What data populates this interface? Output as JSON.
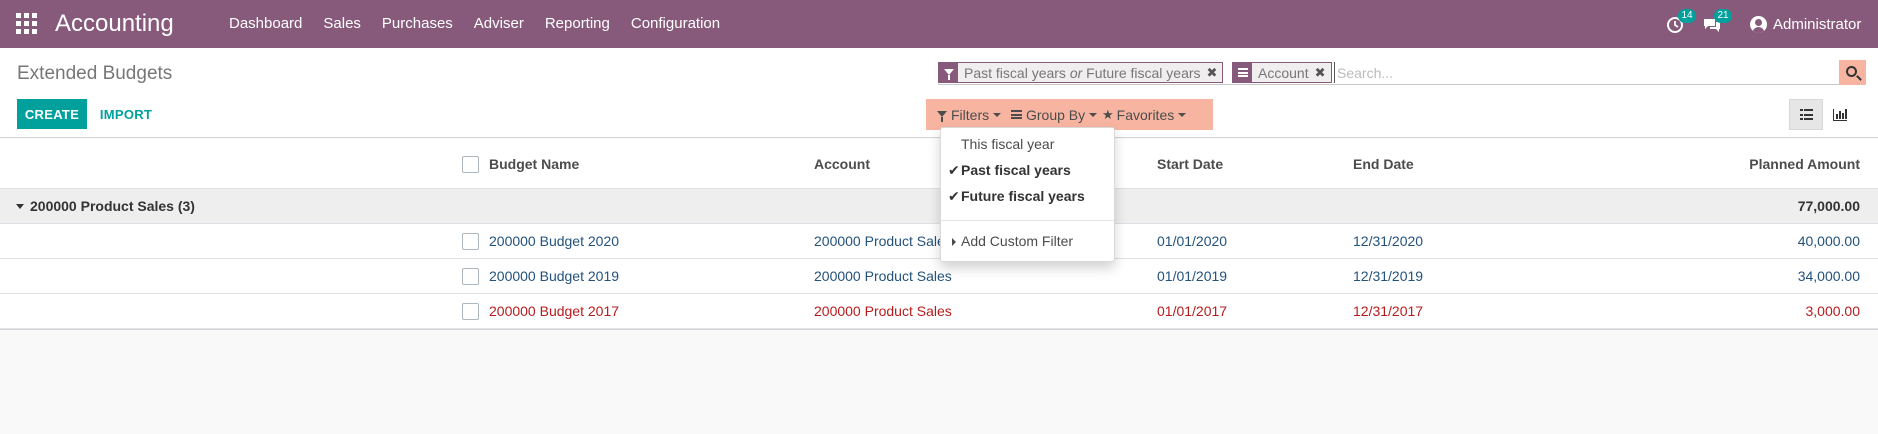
{
  "navbar": {
    "brand": "Accounting",
    "menu": [
      "Dashboard",
      "Sales",
      "Purchases",
      "Adviser",
      "Reporting",
      "Configuration"
    ],
    "activity_count": "14",
    "messages_count": "21",
    "user": "Administrator"
  },
  "control_panel": {
    "title": "Extended Budgets",
    "create_label": "CREATE",
    "import_label": "IMPORT",
    "facets": {
      "filter_part1": "Past fiscal years",
      "filter_or": "or",
      "filter_part2": "Future fiscal years",
      "groupby": "Account"
    },
    "search_placeholder": "Search...",
    "filters_label": "Filters",
    "groupby_label": "Group By",
    "favorites_label": "Favorites"
  },
  "filters_dropdown": {
    "items": [
      {
        "label": "This fiscal year",
        "selected": false
      },
      {
        "label": "Past fiscal years",
        "selected": true
      },
      {
        "label": "Future fiscal years",
        "selected": true
      }
    ],
    "custom_label": "Add Custom Filter"
  },
  "table": {
    "columns": {
      "name": "Budget Name",
      "account": "Account",
      "start": "Start Date",
      "end": "End Date",
      "planned": "Planned Amount"
    },
    "group": {
      "label": "200000 Product Sales (3)",
      "total": "77,000.00"
    },
    "rows": [
      {
        "name": "200000 Budget 2020",
        "account": "200000 Product Sales",
        "start": "01/01/2020",
        "end": "12/31/2020",
        "planned": "40,000.00"
      },
      {
        "name": "200000 Budget 2019",
        "account": "200000 Product Sales",
        "start": "01/01/2019",
        "end": "12/31/2019",
        "planned": "34,000.00"
      },
      {
        "name": "200000 Budget 2017",
        "account": "200000 Product Sales",
        "start": "01/01/2017",
        "end": "12/31/2017",
        "planned": "3,000.00"
      }
    ]
  },
  "colors": {
    "brand": "#875a7b",
    "accent": "#00a09d",
    "highlight": "#f7b5a1",
    "link_row": "#23527c",
    "expired_row": "#b71c1c"
  }
}
